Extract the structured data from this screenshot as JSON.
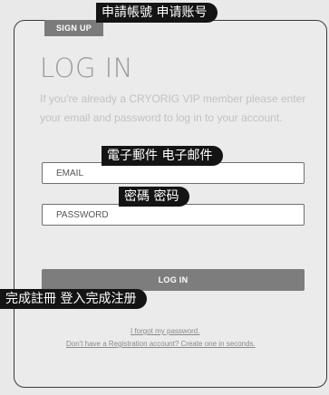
{
  "signup_tab": "SIGN UP",
  "title": "LOG IN",
  "description": "If you're already a CRYORIG VIP member please enter your email and password to log in to your account.",
  "email_field": {
    "placeholder": "EMAIL",
    "value": ""
  },
  "password_field": {
    "placeholder": "PASSWORD",
    "value": ""
  },
  "login_button": "LOG IN",
  "forgot_link": "I forgot my password.",
  "register_link": "Don't have a Registration account? Create one in seconds.",
  "translation_overlays": {
    "signup": "申請帳號 申请账号",
    "email": "電子郵件 电子邮件",
    "password": "密碼 密码",
    "login": "完成註冊 登入完成注册"
  }
}
